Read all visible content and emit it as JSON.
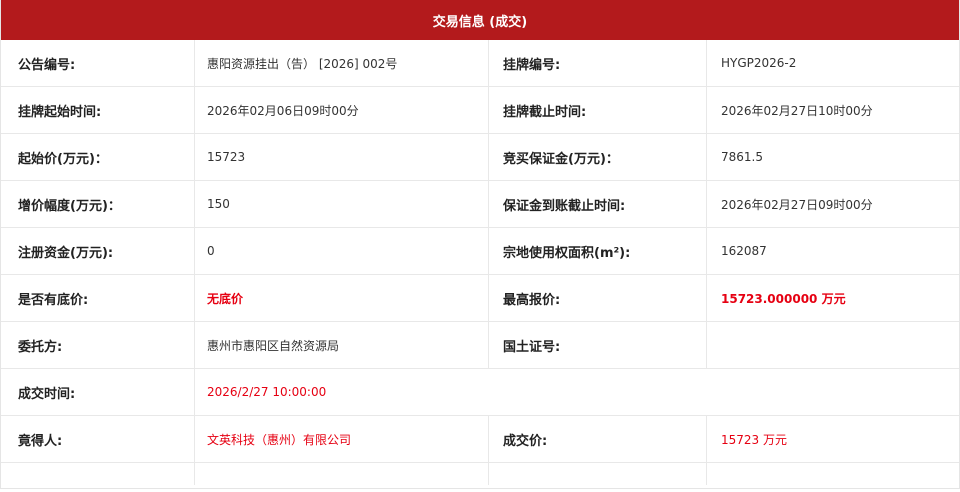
{
  "header": {
    "title": "交易信息 (成交)"
  },
  "rows": [
    {
      "l1": "公告编号:",
      "v1": "惠阳资源挂出（告） [2026] 002号",
      "l2": "挂牌编号:",
      "v2": "HYGP2026-2"
    },
    {
      "l1": "挂牌起始时间:",
      "v1": "2026年02月06日09时00分",
      "l2": "挂牌截止时间:",
      "v2": "2026年02月27日10时00分"
    },
    {
      "l1": "起始价(万元)：",
      "v1": "15723",
      "l2": "竞买保证金(万元)：",
      "v2": "7861.5"
    },
    {
      "l1": "增价幅度(万元)：",
      "v1": "150",
      "l2": "保证金到账截止时间:",
      "v2": "2026年02月27日09时00分"
    },
    {
      "l1": "注册资金(万元):",
      "v1": "0",
      "l2": "宗地使用权面积(m²):",
      "v2": "162087"
    },
    {
      "l1": "是否有底价:",
      "v1": "无底价",
      "l2": "最高报价:",
      "v2": "15723.000000 万元"
    },
    {
      "l1": "委托方:",
      "v1": "惠州市惠阳区自然资源局",
      "l2": "国土证号:",
      "v2": ""
    },
    {
      "l1": "成交时间:",
      "v1": "2026/2/27 10:00:00"
    },
    {
      "l1": "竟得人:",
      "v1": "文英科技（惠州）有限公司",
      "l2": "成交价:",
      "v2": "15723 万元"
    }
  ],
  "colors": {
    "header_bg": "#b31a1c",
    "highlight": "#e60012"
  }
}
